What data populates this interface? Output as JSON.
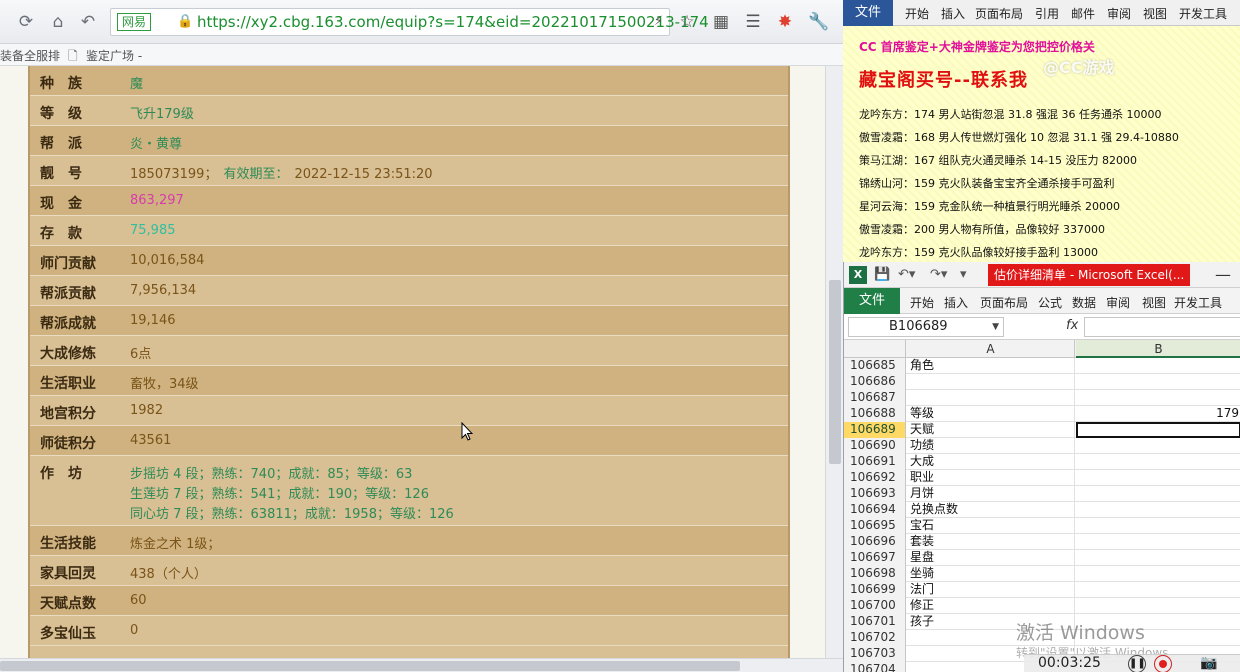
{
  "browser": {
    "site_tag": "网易",
    "url": "https://xy2.cbg.163.com/equip?s=174&eid=202210171500213-174",
    "bookmarks": [
      "装备全服排",
      "鉴定广场 -"
    ],
    "rows": [
      {
        "label": "种　族",
        "value": "魔",
        "style": "green"
      },
      {
        "label": "等　级",
        "value": "飞升179级",
        "style": "green"
      },
      {
        "label": "帮　派",
        "value": "炎・黄尊",
        "style": "green"
      },
      {
        "label": "靓　号",
        "value": "185073199；",
        "tag": "有效期至：",
        "extra": "2022-12-15 23:51:20",
        "style": "brown"
      },
      {
        "label": "现　金",
        "value": "863,297",
        "style": "pink"
      },
      {
        "label": "存　款",
        "value": "75,985",
        "style": "cyan"
      },
      {
        "label": "师门贡献",
        "value": "10,016,584",
        "style": "brown"
      },
      {
        "label": "帮派贡献",
        "value": "7,956,134",
        "style": "brown"
      },
      {
        "label": "帮派成就",
        "value": "19,146",
        "style": "brown"
      },
      {
        "label": "大成修炼",
        "value": "6点",
        "style": "brown"
      },
      {
        "label": "生活职业",
        "value": "畜牧，34级",
        "style": "brown"
      },
      {
        "label": "地宫积分",
        "value": "1982",
        "style": "brown"
      },
      {
        "label": "师徒积分",
        "value": "43561",
        "style": "brown"
      }
    ],
    "workshop": {
      "label": "作　坊",
      "lines": [
        "步摇坊 4 段；熟练：740；成就：85；等级：63",
        "生莲坊 7 段；熟练：541；成就：190；等级：126",
        "同心坊 7 段；熟练：63811；成就：1958；等级：126"
      ]
    },
    "rows2": [
      {
        "label": "生活技能",
        "value": "炼金之术 1级；",
        "style": "brown"
      },
      {
        "label": "家具回灵",
        "value": "438（个人）",
        "style": "brown"
      },
      {
        "label": "天赋点数",
        "value": "60",
        "style": "brown"
      },
      {
        "label": "多宝仙玉",
        "value": "0",
        "style": "brown"
      }
    ]
  },
  "word": {
    "file_tab": "文件",
    "menu": [
      "开始",
      "插入",
      "页面布局",
      "引用",
      "邮件",
      "审阅",
      "视图",
      "开发工具"
    ],
    "line1": "CC 首席鉴定+大神金牌鉴定为您把控价格关",
    "line2": "藏宝阁买号--联系我",
    "watermark": "@CC游戏",
    "entries": [
      "龙吟东方：174 男人站街忽混 31.8 强混 36 任务通杀 10000",
      "傲雪凌霜：168 男人传世燃灯强化 10 忽混 31.1 强 29.4-10880",
      "策马江湖：167 组队克火通灵睡杀 14-15 没压力 82000",
      "锦绣山河：159 克火队装备宝宝齐全通杀接手可盈利",
      "星河云海：159 克金队统一种植景行明光睡杀 20000",
      "傲雪凌霜：200 男人物有所值，品像较好 337000",
      "龙吟东方：159 克火队品像较好接手盈利 13000"
    ]
  },
  "excel": {
    "title": "估价详细清单 - Microsoft Excel(...",
    "file_tab": "文件",
    "menu": [
      "开始",
      "插入",
      "页面布局",
      "公式",
      "数据",
      "审阅",
      "视图",
      "开发工具"
    ],
    "name_box": "B106689",
    "fx": "fx",
    "col_a": "A",
    "col_b": "B",
    "rows": [
      {
        "n": "106685",
        "a": "角色",
        "b": ""
      },
      {
        "n": "106686",
        "a": "",
        "b": ""
      },
      {
        "n": "106687",
        "a": "",
        "b": ""
      },
      {
        "n": "106688",
        "a": "等级",
        "b": "179"
      },
      {
        "n": "106689",
        "a": "天赋",
        "b": ""
      },
      {
        "n": "106690",
        "a": "功绩",
        "b": ""
      },
      {
        "n": "106691",
        "a": "大成",
        "b": ""
      },
      {
        "n": "106692",
        "a": "职业",
        "b": ""
      },
      {
        "n": "106693",
        "a": "月饼",
        "b": ""
      },
      {
        "n": "106694",
        "a": "兑换点数",
        "b": ""
      },
      {
        "n": "106695",
        "a": "宝石",
        "b": ""
      },
      {
        "n": "106696",
        "a": "套装",
        "b": ""
      },
      {
        "n": "106697",
        "a": "星盘",
        "b": ""
      },
      {
        "n": "106698",
        "a": "坐骑",
        "b": ""
      },
      {
        "n": "106699",
        "a": "法门",
        "b": ""
      },
      {
        "n": "106700",
        "a": "修正",
        "b": ""
      },
      {
        "n": "106701",
        "a": "孩子",
        "b": ""
      },
      {
        "n": "106702",
        "a": "",
        "b": ""
      },
      {
        "n": "106703",
        "a": "",
        "b": ""
      },
      {
        "n": "106704",
        "a": "",
        "b": ""
      }
    ],
    "selected_row": "106689",
    "activate_title": "激活 Windows",
    "activate_sub": "转到\"设置\"以激活 Windows。",
    "rec_time": "00:03:25"
  }
}
